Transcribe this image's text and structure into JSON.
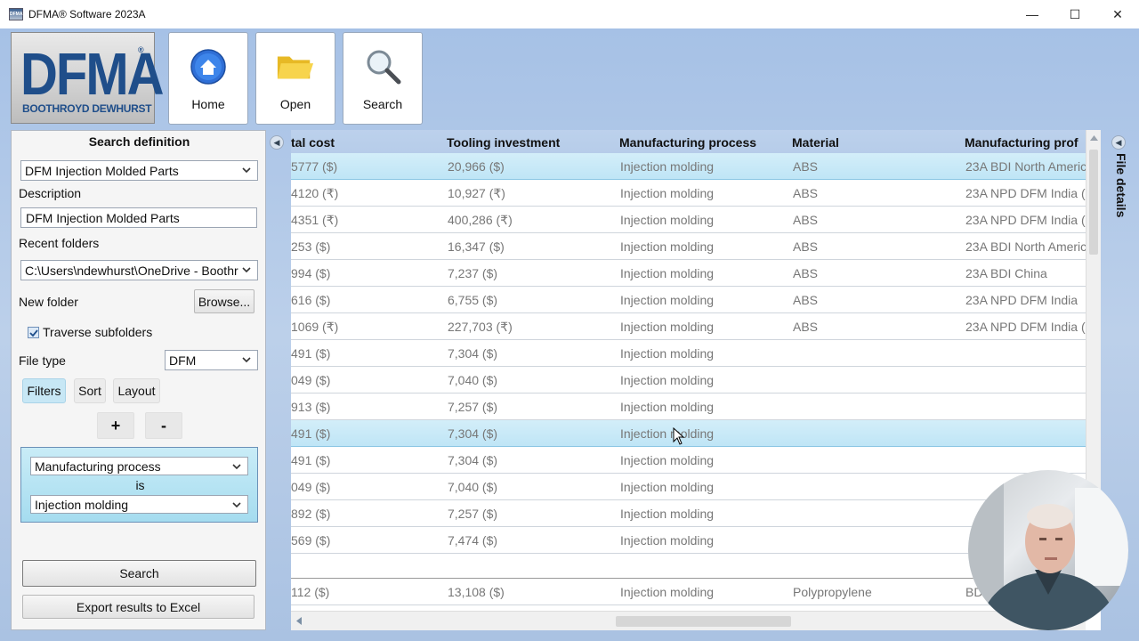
{
  "window": {
    "title": "DFMA® Software 2023A",
    "app_icon_text": "DFMA",
    "minimize": "—",
    "maximize": "☐",
    "close": "✕"
  },
  "logo": {
    "main": "DFMA",
    "reg": "®",
    "sub": "BOOTHROYD DEWHURST"
  },
  "toolbar": {
    "home": "Home",
    "open": "Open",
    "search": "Search"
  },
  "search_definition": {
    "title": "Search definition",
    "type_selected": "DFM Injection Molded Parts",
    "description_label": "Description",
    "description_value": "DFM Injection Molded Parts",
    "recent_folders_label": "Recent folders",
    "recent_folder_selected": "C:\\Users\\ndewhurst\\OneDrive - Boothroyd",
    "new_folder_label": "New folder",
    "browse_label": "Browse...",
    "traverse_label": "Traverse subfolders",
    "traverse_checked": true,
    "file_type_label": "File type",
    "file_type_selected": "DFM",
    "tabs": {
      "filters": "Filters",
      "sort": "Sort",
      "layout": "Layout"
    },
    "add_label": "+",
    "remove_label": "-",
    "filter": {
      "field": "Manufacturing process",
      "operator": "is",
      "value": "Injection molding"
    },
    "search_button": "Search",
    "export_button": "Export results to Excel"
  },
  "grid": {
    "columns": [
      "tal cost",
      "Tooling investment",
      "Manufacturing process",
      "Material",
      "Manufacturing prof"
    ],
    "rows": [
      [
        "5777 ($)",
        "20,966 ($)",
        "Injection molding",
        "ABS",
        "23A BDI North Americ"
      ],
      [
        "4120 (₹)",
        "10,927 (₹)",
        "Injection molding",
        "ABS",
        "23A NPD DFM India (₹"
      ],
      [
        "4351 (₹)",
        "400,286 (₹)",
        "Injection molding",
        "ABS",
        "23A NPD DFM India (₹"
      ],
      [
        "253 ($)",
        "16,347 ($)",
        "Injection molding",
        "ABS",
        "23A BDI North Americ"
      ],
      [
        "994 ($)",
        "7,237 ($)",
        "Injection molding",
        "ABS",
        "23A BDI China"
      ],
      [
        "616 ($)",
        "6,755 ($)",
        "Injection molding",
        "ABS",
        "23A NPD DFM India"
      ],
      [
        "1069 (₹)",
        "227,703 (₹)",
        "Injection molding",
        "ABS",
        "23A NPD DFM India (₹"
      ],
      [
        "491 ($)",
        "7,304 ($)",
        "Injection molding",
        "",
        ""
      ],
      [
        "049 ($)",
        "7,040 ($)",
        "Injection molding",
        "",
        ""
      ],
      [
        "913 ($)",
        "7,257 ($)",
        "Injection molding",
        "",
        ""
      ],
      [
        "491 ($)",
        "7,304 ($)",
        "Injection molding",
        "",
        ""
      ],
      [
        "491 ($)",
        "7,304 ($)",
        "Injection molding",
        "",
        ""
      ],
      [
        "049 ($)",
        "7,040 ($)",
        "Injection molding",
        "",
        ""
      ],
      [
        "892 ($)",
        "7,257 ($)",
        "Injection molding",
        "",
        ""
      ],
      [
        "569 ($)",
        "7,474 ($)",
        "Injection molding",
        "",
        ""
      ],
      [
        "",
        "",
        "",
        "",
        ""
      ],
      [
        "112 ($)",
        "13,108 ($)",
        "Injection molding",
        "Polypropylene",
        "BD"
      ]
    ],
    "selected_rows": [
      0,
      10
    ]
  },
  "side_panel": {
    "file_details": "File details"
  },
  "colors": {
    "accent": "#1f4e8a",
    "selection": "#bfe5f6",
    "header": "#b6cce9"
  }
}
